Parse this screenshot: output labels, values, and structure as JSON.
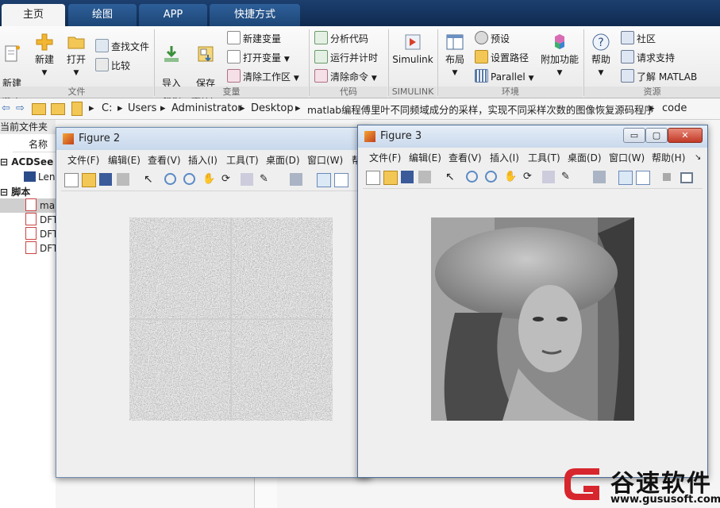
{
  "tabs": [
    {
      "label": "主页",
      "active": true
    },
    {
      "label": "绘图",
      "active": false
    },
    {
      "label": "APP",
      "active": false
    },
    {
      "label": "快捷方式",
      "active": false
    }
  ],
  "ribbon": {
    "file": {
      "new_script": "新建\n脚本",
      "new": "新建",
      "open": "打开",
      "find_files": "查找文件",
      "compare": "比较",
      "group": "文件"
    },
    "variable": {
      "import": "导入\n数据",
      "save_ws": "保存\n工作区",
      "new_var": "新建变量",
      "open_var": "打开变量",
      "clear_ws": "清除工作区",
      "group": "变量"
    },
    "code": {
      "analyze": "分析代码",
      "run_time": "运行并计时",
      "clear_cmds": "清除命令",
      "group": "代码"
    },
    "simulink": {
      "label": "Simulink",
      "group": "SIMULINK"
    },
    "env": {
      "layout": "布局",
      "prefs": "预设",
      "set_path": "设置路径",
      "parallel": "Parallel",
      "addons": "附加功能",
      "group": "环境"
    },
    "resources": {
      "help": "帮助",
      "community": "社区",
      "support": "请求支持",
      "learn": "了解 MATLAB",
      "group": "资源"
    }
  },
  "address": {
    "crumbs": [
      "C:",
      "Users",
      "Administrator",
      "Desktop",
      "matlab编程傅里叶不同频域成分的采样，实现不同采样次数的图像恢复源码程序",
      "code"
    ]
  },
  "left_panel": {
    "title": "当前文件夹",
    "col_name": "名称",
    "group1": "ACDSee B",
    "item1": "Len",
    "group2": "脚本",
    "items": [
      "ma",
      "DFT",
      "DFT",
      "DFT"
    ]
  },
  "figure2": {
    "title": "Figure 2",
    "menus": [
      "文件(F)",
      "编辑(E)",
      "查看(V)",
      "插入(I)",
      "工具(T)",
      "桌面(D)",
      "窗口(W)",
      "帮"
    ]
  },
  "figure3": {
    "title": "Figure 3",
    "menus": [
      "文件(F)",
      "编辑(E)",
      "查看(V)",
      "插入(I)",
      "工具(T)",
      "桌面(D)",
      "窗口(W)",
      "帮助(H)"
    ],
    "controls": {
      "minimize": "▭",
      "maximize": "▢",
      "close": "✕"
    }
  },
  "watermark": {
    "brand": "谷速软件",
    "url": "www.gususoft.com"
  },
  "colors": {
    "tabstrip": "#0f2a4f",
    "accent": "#2e5f99",
    "logo_red": "#d7262d"
  }
}
